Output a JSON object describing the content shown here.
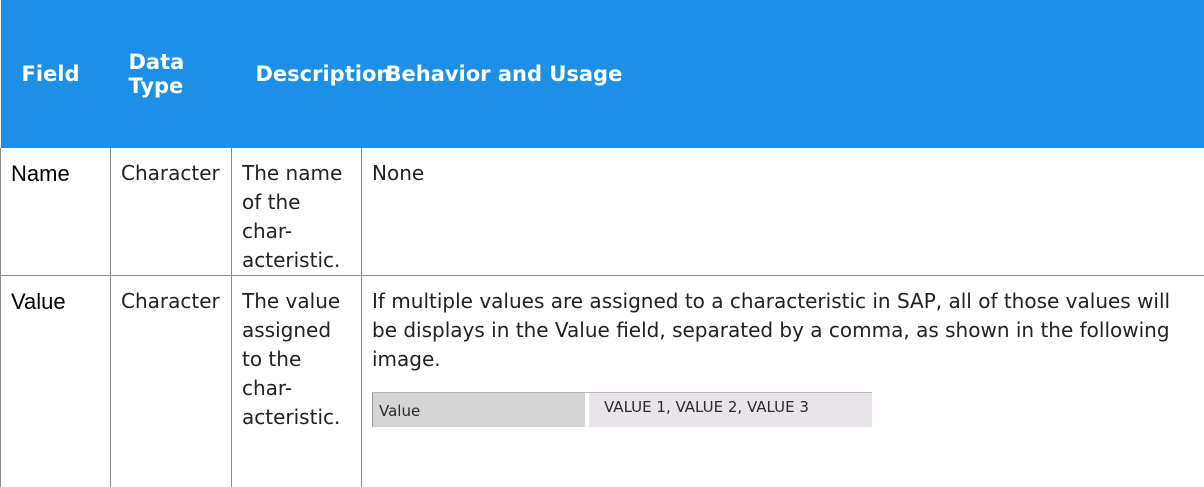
{
  "table": {
    "headers": {
      "field": "Field",
      "data_type": "Data Type",
      "description": "Description",
      "behavior": "Behavior and Usage"
    },
    "rows": [
      {
        "field": "Name",
        "data_type": "Character",
        "description": "The name of the char-acteristic.",
        "behavior": "None"
      },
      {
        "field": "Value",
        "data_type": "Character",
        "description": "The value assigned to the char-acteristic.",
        "behavior": "If multiple values are assigned to a characteristic in SAP, all of those values will be displays in the Value field, separated by a comma, as shown in the following image."
      }
    ]
  },
  "example_image": {
    "label": "Value",
    "value": "VALUE 1,  VALUE 2,  VALUE 3"
  }
}
